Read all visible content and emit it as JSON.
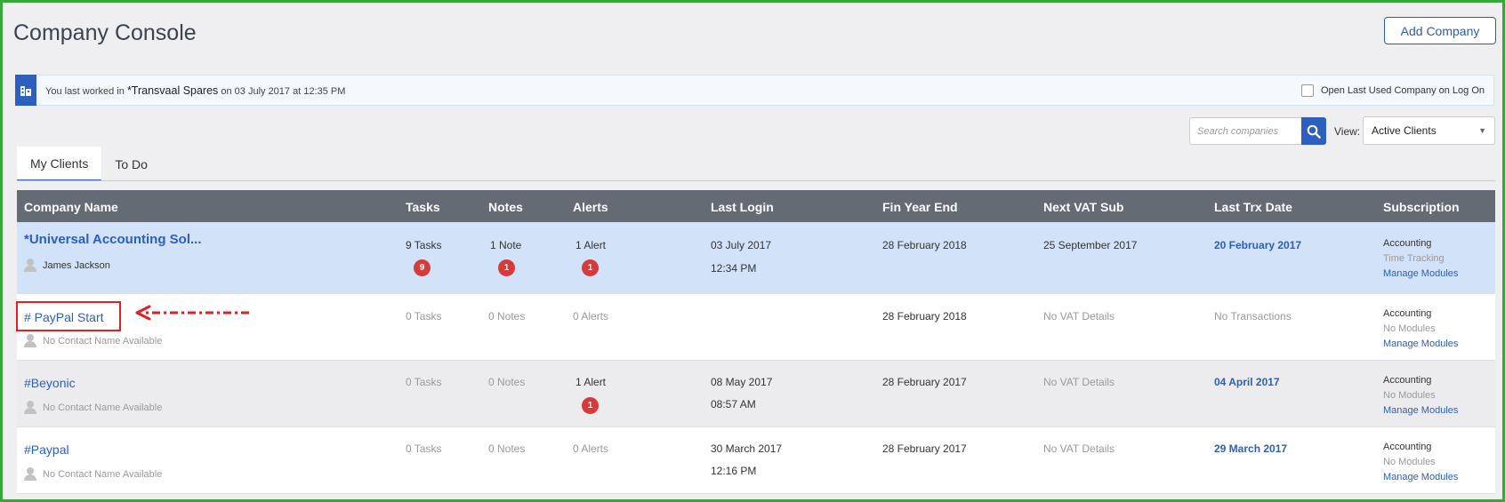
{
  "page": {
    "title": "Company Console",
    "add_company_label": "Add Company"
  },
  "notice": {
    "prefix": "You last worked in ",
    "company": "*Transvaal Spares",
    "suffix": " on 03 July 2017 at 12:35 PM",
    "open_last_label": "Open Last Used Company on Log On"
  },
  "search": {
    "placeholder": "Search companies",
    "view_label": "View:",
    "view_value": "Active Clients"
  },
  "tabs": [
    {
      "label": "My Clients",
      "active": true
    },
    {
      "label": "To Do",
      "active": false
    }
  ],
  "table": {
    "headers": {
      "company": "Company Name",
      "tasks": "Tasks",
      "notes": "Notes",
      "alerts": "Alerts",
      "last_login": "Last Login",
      "fin_year_end": "Fin Year End",
      "next_vat": "Next VAT Sub",
      "last_trx": "Last Trx Date",
      "subscription": "Subscription"
    },
    "rows": [
      {
        "name": "*Universal Accounting Sol...",
        "contact": "James Jackson",
        "tasks": "9 Tasks",
        "tasks_badge": "9",
        "notes": "1 Note",
        "notes_badge": "1",
        "alerts": "1 Alert",
        "alerts_badge": "1",
        "login_date": "03 July 2017",
        "login_time": "12:34 PM",
        "fin_year_end": "28 February 2018",
        "next_vat": "25 September 2017",
        "last_trx": "20 February 2017",
        "sub_main": "Accounting",
        "sub_modules": "Time Tracking",
        "manage": "Manage Modules"
      },
      {
        "name": "# PayPal Start",
        "contact": "No Contact Name Available",
        "tasks": "0 Tasks",
        "notes": "0 Notes",
        "alerts": "0 Alerts",
        "fin_year_end": "28 February 2018",
        "next_vat": "No VAT Details",
        "last_trx": "No Transactions",
        "sub_main": "Accounting",
        "sub_modules": "No Modules",
        "manage": "Manage Modules"
      },
      {
        "name": "#Beyonic",
        "contact": "No Contact Name Available",
        "tasks": "0 Tasks",
        "notes": "0 Notes",
        "alerts": "1 Alert",
        "alerts_badge": "1",
        "login_date": "08 May 2017",
        "login_time": "08:57 AM",
        "fin_year_end": "28 February 2017",
        "next_vat": "No VAT Details",
        "last_trx": "04 April 2017",
        "sub_main": "Accounting",
        "sub_modules": "No Modules",
        "manage": "Manage Modules"
      },
      {
        "name": "#Paypal",
        "contact": "No Contact Name Available",
        "tasks": "0 Tasks",
        "notes": "0 Notes",
        "alerts": "0 Alerts",
        "login_date": "30 March 2017",
        "login_time": "12:16 PM",
        "fin_year_end": "28 February 2017",
        "next_vat": "No VAT Details",
        "last_trx": "29 March 2017",
        "sub_main": "Accounting",
        "sub_modules": "No Modules",
        "manage": "Manage Modules"
      }
    ]
  },
  "colors": {
    "accent": "#2d5fbf",
    "header_bg": "#656b75",
    "selected_row": "#d1e2f9",
    "badge": "#d43c3c",
    "annotation": "#e02020",
    "frame": "#3aa53a"
  }
}
